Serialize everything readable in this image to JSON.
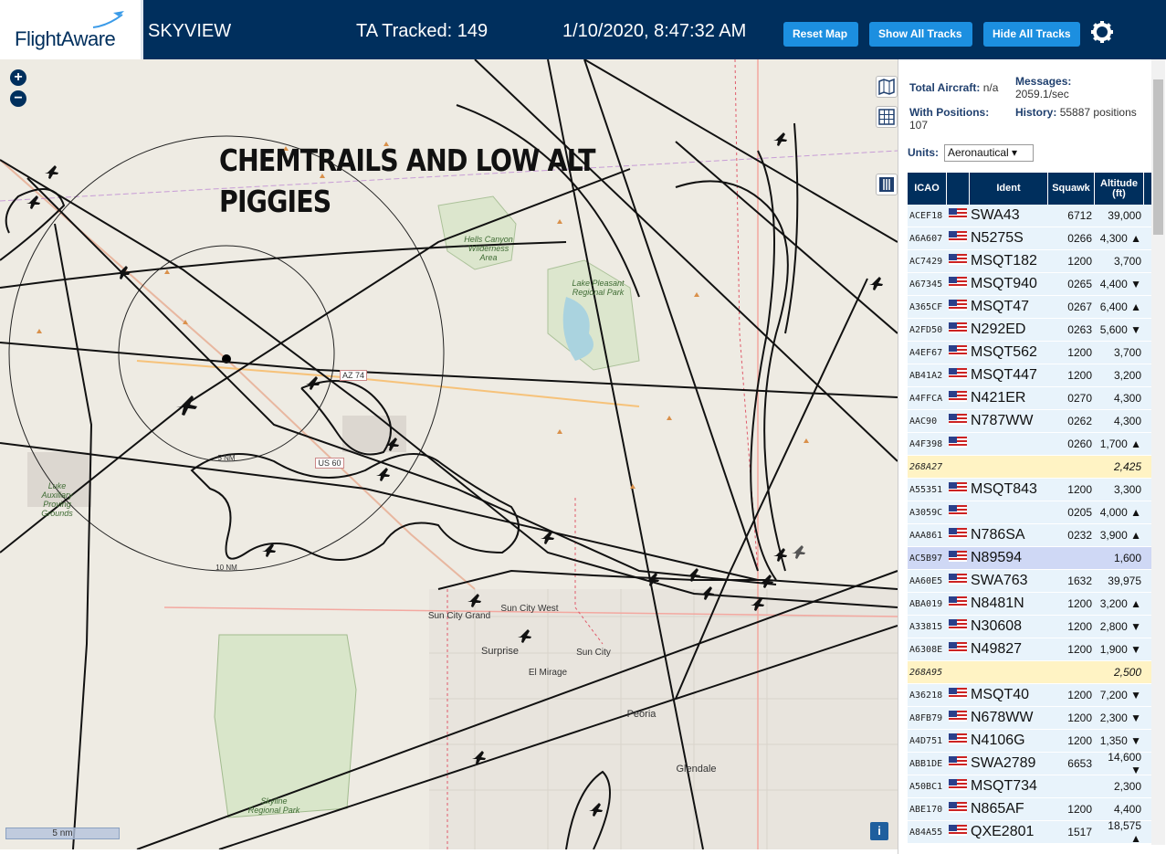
{
  "header": {
    "logo": "FlightAware",
    "title": "SKYVIEW",
    "ta_tracked": "TA Tracked: 149",
    "datetime": "1/10/2020, 8:47:32 AM",
    "reset_label": "Reset Map",
    "show_label": "Show All Tracks",
    "hide_label": "Hide All Tracks"
  },
  "map": {
    "zoom_in": "+",
    "zoom_out": "−",
    "overlay_line1": "CHEMTRAILS AND LOW ALT",
    "overlay_line2": "PIGGIES",
    "scale_label": "5 nm",
    "info": "i",
    "ring_5": "5 NM",
    "ring_10": "10 NM",
    "labels": {
      "hells_canyon": "Hells Canyon Wilderness Area",
      "lake_pleasant": "Lake Pleasant Regional Park",
      "luke": "Luke Auxiliary Proving Grounds",
      "sun_city_grand": "Sun City Grand",
      "sun_city_west": "Sun City West",
      "surprise": "Surprise",
      "sun_city": "Sun City",
      "el_mirage": "El Mirage",
      "peoria": "Peoria",
      "glendale": "Glendale",
      "skyline": "Skyline Regional Park",
      "az74": "AZ 74",
      "us60": "US 60"
    }
  },
  "sidebar": {
    "total_label": "Total Aircraft:",
    "total_value": "n/a",
    "messages_label": "Messages:",
    "messages_value": "2059.1/sec",
    "positions_label": "With Positions:",
    "positions_value": "107",
    "history_label": "History:",
    "history_value": "55887 positions",
    "units_label": "Units:",
    "units_value": "Aeronautical ▾",
    "columns": {
      "icao": "ICAO",
      "ident": "Ident",
      "squawk": "Squawk",
      "altitude": "Altitude (ft)"
    }
  },
  "aircraft": [
    {
      "icao": "ACEF18",
      "ident": "SWA43",
      "squawk": "6712",
      "alt": "39,000",
      "type": "normal"
    },
    {
      "icao": "A6A607",
      "ident": "N5275S",
      "squawk": "0266",
      "alt": "4,300 ▲",
      "type": "normal"
    },
    {
      "icao": "AC7429",
      "ident": "MSQT182",
      "squawk": "1200",
      "alt": "3,700",
      "type": "normal"
    },
    {
      "icao": "A67345",
      "ident": "MSQT940",
      "squawk": "0265",
      "alt": "4,400 ▼",
      "type": "normal"
    },
    {
      "icao": "A365CF",
      "ident": "MSQT47",
      "squawk": "0267",
      "alt": "6,400 ▲",
      "type": "normal"
    },
    {
      "icao": "A2FD50",
      "ident": "N292ED",
      "squawk": "0263",
      "alt": "5,600 ▼",
      "type": "normal"
    },
    {
      "icao": "A4EF67",
      "ident": "MSQT562",
      "squawk": "1200",
      "alt": "3,700",
      "type": "normal"
    },
    {
      "icao": "AB41A2",
      "ident": "MSQT447",
      "squawk": "1200",
      "alt": "3,200",
      "type": "normal"
    },
    {
      "icao": "A4FFCA",
      "ident": "N421ER",
      "squawk": "0270",
      "alt": "4,300",
      "type": "normal"
    },
    {
      "icao": "AAC90",
      "ident": "N787WW",
      "squawk": "0262",
      "alt": "4,300",
      "type": "normal"
    },
    {
      "icao": "A4F398",
      "ident": "",
      "squawk": "0260",
      "alt": "1,700 ▲",
      "type": "normal"
    },
    {
      "icao": "268A27",
      "ident": "",
      "squawk": "",
      "alt": "2,425",
      "type": "mil"
    },
    {
      "icao": "A55351",
      "ident": "MSQT843",
      "squawk": "1200",
      "alt": "3,300",
      "type": "normal"
    },
    {
      "icao": "A3059C",
      "ident": "",
      "squawk": "0205",
      "alt": "4,000 ▲",
      "type": "normal"
    },
    {
      "icao": "AAA861",
      "ident": "N786SA",
      "squawk": "0232",
      "alt": "3,900 ▲",
      "type": "normal"
    },
    {
      "icao": "AC5B97",
      "ident": "N89594",
      "squawk": "",
      "alt": "1,600",
      "type": "sel"
    },
    {
      "icao": "AA60E5",
      "ident": "SWA763",
      "squawk": "1632",
      "alt": "39,975",
      "type": "normal"
    },
    {
      "icao": "ABA019",
      "ident": "N8481N",
      "squawk": "1200",
      "alt": "3,200 ▲",
      "type": "normal"
    },
    {
      "icao": "A33815",
      "ident": "N30608",
      "squawk": "1200",
      "alt": "2,800 ▼",
      "type": "normal"
    },
    {
      "icao": "A6308E",
      "ident": "N49827",
      "squawk": "1200",
      "alt": "1,900 ▼",
      "type": "normal"
    },
    {
      "icao": "268A95",
      "ident": "",
      "squawk": "",
      "alt": "2,500",
      "type": "mil"
    },
    {
      "icao": "A36218",
      "ident": "MSQT40",
      "squawk": "1200",
      "alt": "7,200 ▼",
      "type": "normal"
    },
    {
      "icao": "A8FB79",
      "ident": "N678WW",
      "squawk": "1200",
      "alt": "2,300 ▼",
      "type": "normal"
    },
    {
      "icao": "A4D751",
      "ident": "N4106G",
      "squawk": "1200",
      "alt": "1,350 ▼",
      "type": "normal"
    },
    {
      "icao": "ABB1DE",
      "ident": "SWA2789",
      "squawk": "6653",
      "alt": "14,600 ▼",
      "type": "normal"
    },
    {
      "icao": "A50BC1",
      "ident": "MSQT734",
      "squawk": "",
      "alt": "2,300",
      "type": "normal"
    },
    {
      "icao": "ABE170",
      "ident": "N865AF",
      "squawk": "1200",
      "alt": "4,400",
      "type": "normal"
    },
    {
      "icao": "A84A55",
      "ident": "QXE2801",
      "squawk": "1517",
      "alt": "18,575 ▲",
      "type": "normal"
    }
  ]
}
